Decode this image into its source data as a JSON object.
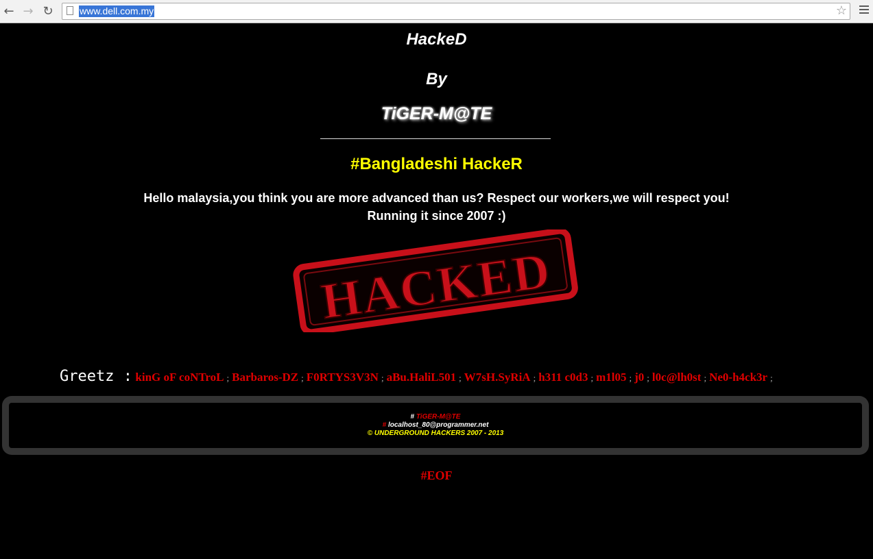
{
  "browser": {
    "url": "www.dell.com.my",
    "back_icon": "back-arrow-icon",
    "forward_icon": "forward-arrow-icon",
    "reload_icon": "reload-icon",
    "star_icon": "star-icon",
    "menu_icon": "menu-icon"
  },
  "page": {
    "title": "HackeD",
    "by": "By",
    "author": "TiGER-M@TE",
    "group": "#Bangladeshi HackeR",
    "message_line1": "Hello malaysia,you think you are more advanced than us? Respect our workers,we will respect you!",
    "message_line2": "Running it since 2007 :)",
    "stamp_text": "HACKED",
    "greetz_label": "Greetz :",
    "greetz": [
      "kinG oF coNTroL",
      "Barbaros-DZ",
      "F0RTYS3V3N",
      "aBu.HaliL501",
      "W7sH.SyRiA",
      "h311 c0d3",
      "m1l05",
      "j0",
      "l0c@lh0st",
      "Ne0-h4ck3r"
    ],
    "greetz_separator": ";",
    "footer": {
      "hash1": "#",
      "author": "TiGER-M@TE",
      "hash2": "#",
      "email": "localhost_80@programmer.net",
      "copyright": "© UNDERGROUND HACKERS 2007 - 2013"
    },
    "eof": "#EOF"
  },
  "colors": {
    "background": "#000000",
    "yellow": "#ffff00",
    "red": "#e00000",
    "stamp_red": "#c8101a"
  }
}
